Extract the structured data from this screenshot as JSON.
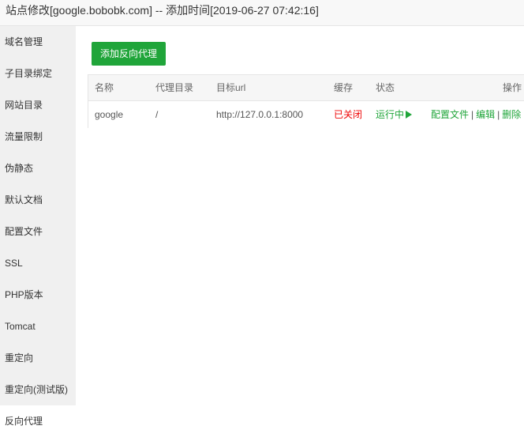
{
  "window": {
    "title": "站点修改[google.bobobk.com] -- 添加时间[2019-06-27 07:42:16]"
  },
  "sidebar": {
    "items": [
      {
        "label": "域名管理"
      },
      {
        "label": "子目录绑定"
      },
      {
        "label": "网站目录"
      },
      {
        "label": "流量限制"
      },
      {
        "label": "伪静态"
      },
      {
        "label": "默认文档"
      },
      {
        "label": "配置文件"
      },
      {
        "label": "SSL"
      },
      {
        "label": "PHP版本"
      },
      {
        "label": "Tomcat"
      },
      {
        "label": "重定向"
      },
      {
        "label": "重定向(测试版)"
      },
      {
        "label": "反向代理"
      }
    ],
    "active_item": "反向代理"
  },
  "main": {
    "add_button_label": "添加反向代理",
    "table": {
      "headers": {
        "name": "名称",
        "proxy_dir": "代理目录",
        "target_url": "目标url",
        "cache": "缓存",
        "status": "状态",
        "actions": "操作"
      },
      "rows": [
        {
          "name": "google",
          "proxy_dir": "/",
          "target_url": "http://127.0.0.1:8000",
          "cache": "已关闭",
          "status": "运行中",
          "actions": {
            "config": "配置文件",
            "edit": "编辑",
            "delete": "删除",
            "separator": "|"
          }
        }
      ]
    }
  },
  "colors": {
    "accent_green": "#20a53a",
    "cache_off_red": "#ef0808",
    "sidebar_bg": "#f0f0f0",
    "table_header_bg": "#f6f6f6"
  },
  "icons": {
    "status_icon": "play-triangle-icon"
  }
}
